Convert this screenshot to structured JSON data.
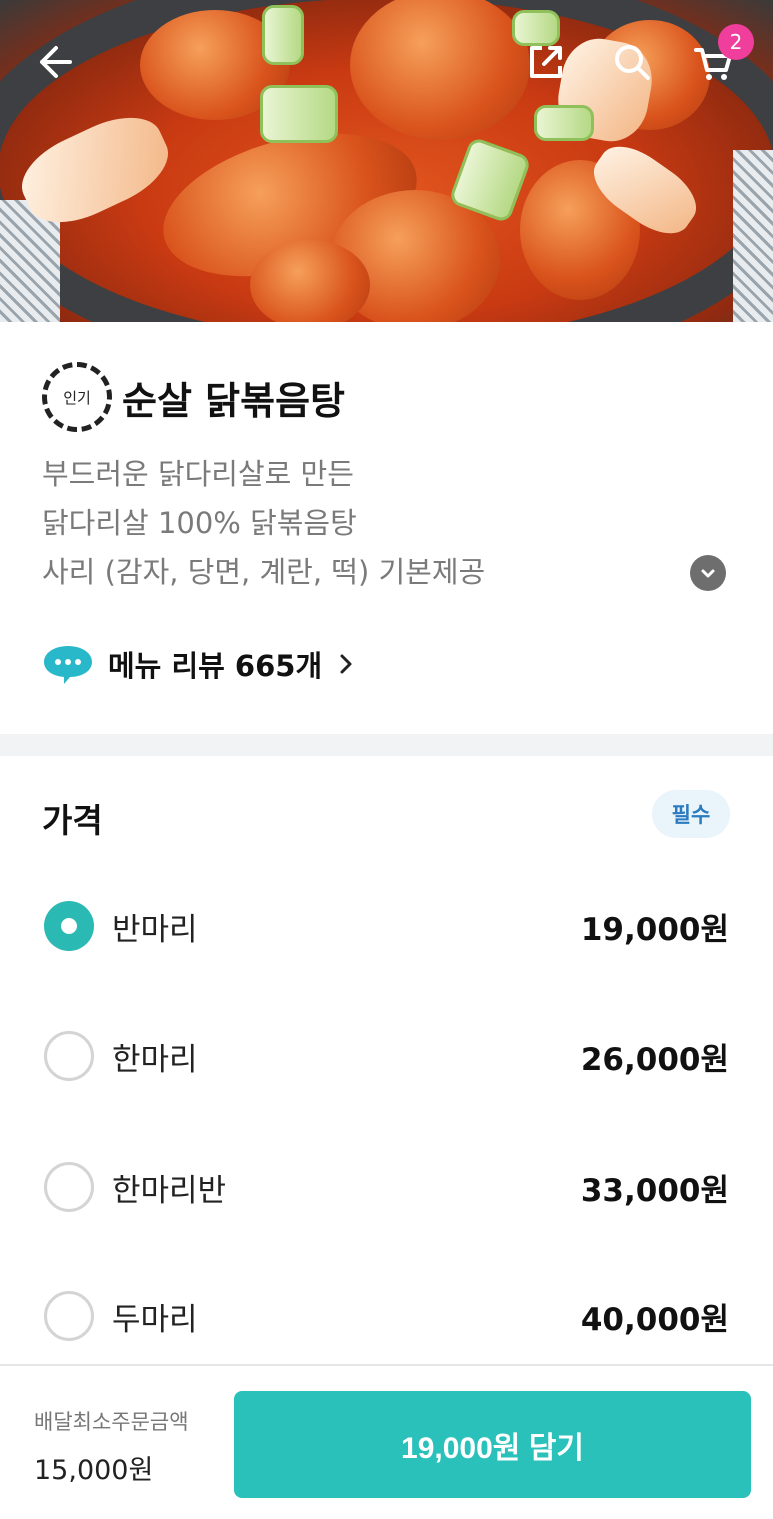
{
  "header": {
    "back_icon": "arrow-left-icon",
    "share_icon": "share-icon",
    "search_icon": "search-icon",
    "cart_icon": "cart-icon",
    "cart_count": "2"
  },
  "menu": {
    "badge": "인기",
    "title": "순살 닭볶음탕",
    "description": [
      "부드러운 닭다리살로 만든",
      "닭다리살 100% 닭볶음탕",
      "사리 (감자, 당면, 계란, 떡) 기본제공"
    ],
    "review_label": "메뉴 리뷰 665개"
  },
  "price": {
    "title": "가격",
    "required_label": "필수",
    "options": [
      {
        "name": "반마리",
        "price": "19,000원",
        "selected": true
      },
      {
        "name": "한마리",
        "price": "26,000원",
        "selected": false
      },
      {
        "name": "한마리반",
        "price": "33,000원",
        "selected": false
      },
      {
        "name": "두마리",
        "price": "40,000원",
        "selected": false
      }
    ]
  },
  "footer": {
    "min_order_label": "배달최소주문금액",
    "min_order_value": "15,000원",
    "add_button_label": "19,000원 담기"
  },
  "colors": {
    "accent": "#2bc1bb",
    "cart_badge": "#ef3e9b",
    "required_badge_text": "#2b7bc0"
  }
}
